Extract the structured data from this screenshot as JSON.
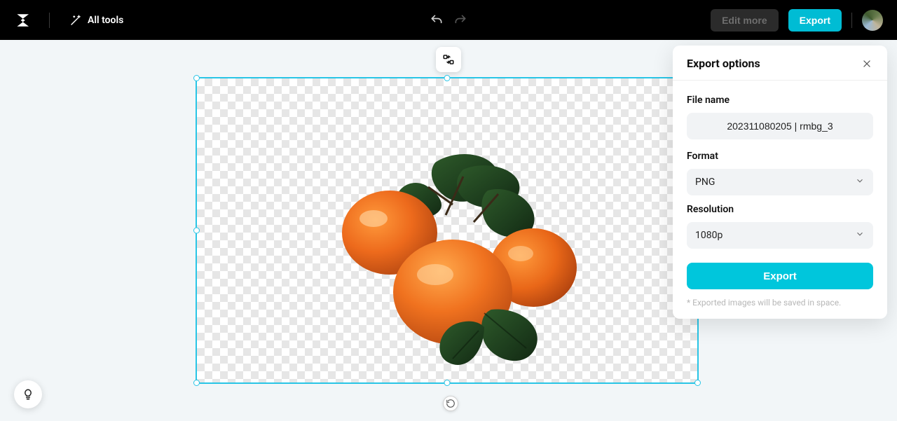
{
  "header": {
    "all_tools_label": "All tools",
    "edit_more_label": "Edit more",
    "export_label": "Export"
  },
  "panel": {
    "title": "Export options",
    "file_name_label": "File name",
    "file_name_value": "202311080205 | rmbg_3",
    "format_label": "Format",
    "format_value": "PNG",
    "resolution_label": "Resolution",
    "resolution_value": "1080p",
    "export_btn": "Export",
    "note": "* Exported images will be saved in space."
  },
  "colors": {
    "accent": "#00bcd4",
    "selection": "#29c5e6"
  }
}
